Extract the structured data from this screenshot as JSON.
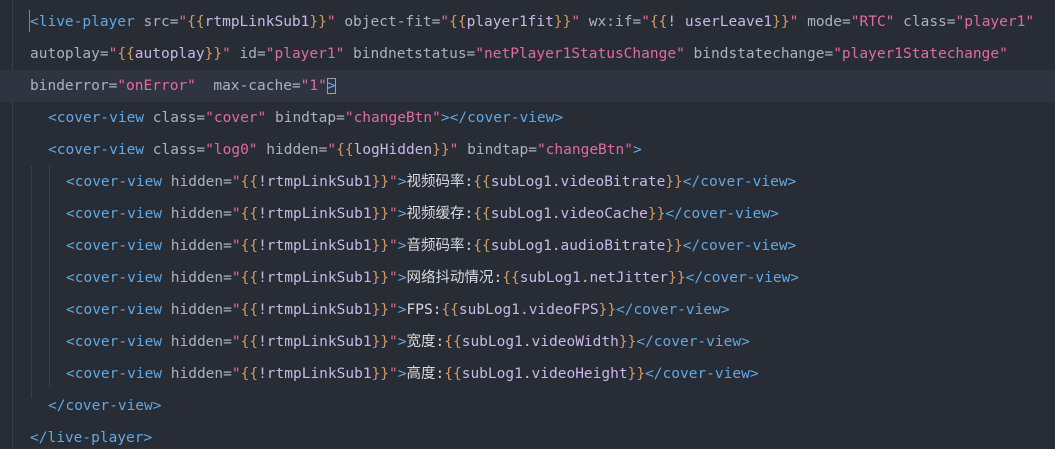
{
  "editor": {
    "theme": {
      "background": "#282c34",
      "current_line": "#2f3440",
      "tag": "#5fa9e6",
      "attribute": "#abb2bf",
      "string": "#e06c9f",
      "brace": "#d19a66",
      "text": "#abb2bf"
    },
    "lines": [
      {
        "name": "code-line-1",
        "indent": 0,
        "current": false,
        "tokens": [
          {
            "t": "tag",
            "v": "<live-player "
          },
          {
            "t": "attr",
            "v": "src="
          },
          {
            "t": "str",
            "v": "\""
          },
          {
            "t": "brace",
            "v": "{{"
          },
          {
            "t": "var",
            "v": "rtmpLinkSub1"
          },
          {
            "t": "brace",
            "v": "}}"
          },
          {
            "t": "str",
            "v": "\""
          },
          {
            "t": "attr",
            "v": " object-fit="
          },
          {
            "t": "str",
            "v": "\""
          },
          {
            "t": "brace",
            "v": "{{"
          },
          {
            "t": "var",
            "v": "player1fit"
          },
          {
            "t": "brace",
            "v": "}}"
          },
          {
            "t": "str",
            "v": "\""
          },
          {
            "t": "attr",
            "v": " wx:if="
          },
          {
            "t": "str",
            "v": "\""
          },
          {
            "t": "brace",
            "v": "{{"
          },
          {
            "t": "var",
            "v": "! userLeave1"
          },
          {
            "t": "brace",
            "v": "}}"
          },
          {
            "t": "str",
            "v": "\""
          },
          {
            "t": "attr",
            "v": " mode="
          },
          {
            "t": "str",
            "v": "\"RTC\""
          },
          {
            "t": "attr",
            "v": " class="
          },
          {
            "t": "str",
            "v": "\"player1\""
          }
        ]
      },
      {
        "name": "code-line-1-wrap-2",
        "indent": 0,
        "current": false,
        "tokens": [
          {
            "t": "attr",
            "v": "autoplay="
          },
          {
            "t": "str",
            "v": "\""
          },
          {
            "t": "brace",
            "v": "{{"
          },
          {
            "t": "var",
            "v": "autoplay"
          },
          {
            "t": "brace",
            "v": "}}"
          },
          {
            "t": "str",
            "v": "\""
          },
          {
            "t": "attr",
            "v": " id="
          },
          {
            "t": "str",
            "v": "\"player1\""
          },
          {
            "t": "attr",
            "v": " bindnetstatus="
          },
          {
            "t": "str",
            "v": "\"netPlayer1StatusChange\""
          },
          {
            "t": "attr",
            "v": " bindstatechange="
          },
          {
            "t": "str",
            "v": "\"player1Statechange\""
          }
        ]
      },
      {
        "name": "code-line-1-wrap-3",
        "indent": 0,
        "current": true,
        "tokens": [
          {
            "t": "attr",
            "v": "binderror="
          },
          {
            "t": "str",
            "v": "\"onError\""
          },
          {
            "t": "attr",
            "v": "  max-cache="
          },
          {
            "t": "str",
            "v": "\"1\""
          },
          {
            "t": "tag",
            "v": ">",
            "cursor": true
          }
        ]
      },
      {
        "name": "code-line-2",
        "indent": 1,
        "current": false,
        "tokens": [
          {
            "t": "tag",
            "v": "<cover-view "
          },
          {
            "t": "attr",
            "v": "class="
          },
          {
            "t": "str",
            "v": "\"cover\""
          },
          {
            "t": "attr",
            "v": " bindtap="
          },
          {
            "t": "str",
            "v": "\"changeBtn\""
          },
          {
            "t": "tag",
            "v": "></cover-view>"
          }
        ]
      },
      {
        "name": "code-line-3",
        "indent": 1,
        "current": false,
        "tokens": [
          {
            "t": "tag",
            "v": "<cover-view "
          },
          {
            "t": "attr",
            "v": "class="
          },
          {
            "t": "str",
            "v": "\"log0\""
          },
          {
            "t": "attr",
            "v": " hidden="
          },
          {
            "t": "str",
            "v": "\""
          },
          {
            "t": "brace",
            "v": "{{"
          },
          {
            "t": "var",
            "v": "logHidden"
          },
          {
            "t": "brace",
            "v": "}}"
          },
          {
            "t": "str",
            "v": "\""
          },
          {
            "t": "attr",
            "v": " bindtap="
          },
          {
            "t": "str",
            "v": "\"changeBtn\""
          },
          {
            "t": "tag",
            "v": ">"
          }
        ]
      },
      {
        "name": "code-line-4",
        "indent": 2,
        "current": false,
        "tokens": [
          {
            "t": "tag",
            "v": "<cover-view "
          },
          {
            "t": "attr",
            "v": "hidden="
          },
          {
            "t": "str",
            "v": "\""
          },
          {
            "t": "brace",
            "v": "{{"
          },
          {
            "t": "var",
            "v": "!rtmpLinkSub1"
          },
          {
            "t": "brace",
            "v": "}}"
          },
          {
            "t": "str",
            "v": "\""
          },
          {
            "t": "tag",
            "v": ">"
          },
          {
            "t": "cn",
            "v": "视频码率:"
          },
          {
            "t": "brace",
            "v": "{{"
          },
          {
            "t": "var",
            "v": "subLog1.videoBitrate"
          },
          {
            "t": "brace",
            "v": "}}"
          },
          {
            "t": "tag",
            "v": "</cover-view>"
          }
        ]
      },
      {
        "name": "code-line-5",
        "indent": 2,
        "current": false,
        "tokens": [
          {
            "t": "tag",
            "v": "<cover-view "
          },
          {
            "t": "attr",
            "v": "hidden="
          },
          {
            "t": "str",
            "v": "\""
          },
          {
            "t": "brace",
            "v": "{{"
          },
          {
            "t": "var",
            "v": "!rtmpLinkSub1"
          },
          {
            "t": "brace",
            "v": "}}"
          },
          {
            "t": "str",
            "v": "\""
          },
          {
            "t": "tag",
            "v": ">"
          },
          {
            "t": "cn",
            "v": "视频缓存:"
          },
          {
            "t": "brace",
            "v": "{{"
          },
          {
            "t": "var",
            "v": "subLog1.videoCache"
          },
          {
            "t": "brace",
            "v": "}}"
          },
          {
            "t": "tag",
            "v": "</cover-view>"
          }
        ]
      },
      {
        "name": "code-line-6",
        "indent": 2,
        "current": false,
        "tokens": [
          {
            "t": "tag",
            "v": "<cover-view "
          },
          {
            "t": "attr",
            "v": "hidden="
          },
          {
            "t": "str",
            "v": "\""
          },
          {
            "t": "brace",
            "v": "{{"
          },
          {
            "t": "var",
            "v": "!rtmpLinkSub1"
          },
          {
            "t": "brace",
            "v": "}}"
          },
          {
            "t": "str",
            "v": "\""
          },
          {
            "t": "tag",
            "v": ">"
          },
          {
            "t": "cn",
            "v": "音频码率:"
          },
          {
            "t": "brace",
            "v": "{{"
          },
          {
            "t": "var",
            "v": "subLog1.audioBitrate"
          },
          {
            "t": "brace",
            "v": "}}"
          },
          {
            "t": "tag",
            "v": "</cover-view>"
          }
        ]
      },
      {
        "name": "code-line-7",
        "indent": 2,
        "current": false,
        "tokens": [
          {
            "t": "tag",
            "v": "<cover-view "
          },
          {
            "t": "attr",
            "v": "hidden="
          },
          {
            "t": "str",
            "v": "\""
          },
          {
            "t": "brace",
            "v": "{{"
          },
          {
            "t": "var",
            "v": "!rtmpLinkSub1"
          },
          {
            "t": "brace",
            "v": "}}"
          },
          {
            "t": "str",
            "v": "\""
          },
          {
            "t": "tag",
            "v": ">"
          },
          {
            "t": "cn",
            "v": "网络抖动情况:"
          },
          {
            "t": "brace",
            "v": "{{"
          },
          {
            "t": "var",
            "v": "subLog1.netJitter"
          },
          {
            "t": "brace",
            "v": "}}"
          },
          {
            "t": "tag",
            "v": "</cover-view>"
          }
        ]
      },
      {
        "name": "code-line-8",
        "indent": 2,
        "current": false,
        "tokens": [
          {
            "t": "tag",
            "v": "<cover-view "
          },
          {
            "t": "attr",
            "v": "hidden="
          },
          {
            "t": "str",
            "v": "\""
          },
          {
            "t": "brace",
            "v": "{{"
          },
          {
            "t": "var",
            "v": "!rtmpLinkSub1"
          },
          {
            "t": "brace",
            "v": "}}"
          },
          {
            "t": "str",
            "v": "\""
          },
          {
            "t": "tag",
            "v": ">"
          },
          {
            "t": "cn",
            "v": "FPS:"
          },
          {
            "t": "brace",
            "v": "{{"
          },
          {
            "t": "var",
            "v": "subLog1.videoFPS"
          },
          {
            "t": "brace",
            "v": "}}"
          },
          {
            "t": "tag",
            "v": "</cover-view>"
          }
        ]
      },
      {
        "name": "code-line-9",
        "indent": 2,
        "current": false,
        "tokens": [
          {
            "t": "tag",
            "v": "<cover-view "
          },
          {
            "t": "attr",
            "v": "hidden="
          },
          {
            "t": "str",
            "v": "\""
          },
          {
            "t": "brace",
            "v": "{{"
          },
          {
            "t": "var",
            "v": "!rtmpLinkSub1"
          },
          {
            "t": "brace",
            "v": "}}"
          },
          {
            "t": "str",
            "v": "\""
          },
          {
            "t": "tag",
            "v": ">"
          },
          {
            "t": "cn",
            "v": "宽度:"
          },
          {
            "t": "brace",
            "v": "{{"
          },
          {
            "t": "var",
            "v": "subLog1.videoWidth"
          },
          {
            "t": "brace",
            "v": "}}"
          },
          {
            "t": "tag",
            "v": "</cover-view>"
          }
        ]
      },
      {
        "name": "code-line-10",
        "indent": 2,
        "current": false,
        "tokens": [
          {
            "t": "tag",
            "v": "<cover-view "
          },
          {
            "t": "attr",
            "v": "hidden="
          },
          {
            "t": "str",
            "v": "\""
          },
          {
            "t": "brace",
            "v": "{{"
          },
          {
            "t": "var",
            "v": "!rtmpLinkSub1"
          },
          {
            "t": "brace",
            "v": "}}"
          },
          {
            "t": "str",
            "v": "\""
          },
          {
            "t": "tag",
            "v": ">"
          },
          {
            "t": "cn",
            "v": "高度:"
          },
          {
            "t": "brace",
            "v": "{{"
          },
          {
            "t": "var",
            "v": "subLog1.videoHeight"
          },
          {
            "t": "brace",
            "v": "}}"
          },
          {
            "t": "tag",
            "v": "</cover-view>"
          }
        ]
      },
      {
        "name": "code-line-11",
        "indent": 1,
        "current": false,
        "tokens": [
          {
            "t": "tag",
            "v": "</cover-view>"
          }
        ]
      },
      {
        "name": "code-line-12",
        "indent": 0,
        "current": false,
        "tokens": [
          {
            "t": "tag",
            "v": "</live-player>"
          }
        ]
      }
    ]
  }
}
